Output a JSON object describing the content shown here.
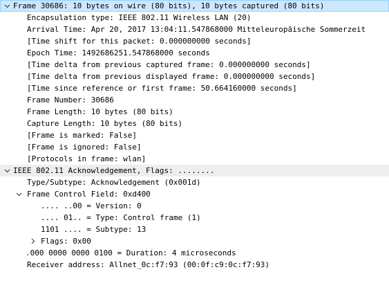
{
  "frame": {
    "header": "Frame 30686: 10 bytes on wire (80 bits), 10 bytes captured (80 bits)",
    "fields": [
      "Encapsulation type: IEEE 802.11 Wireless LAN (20)",
      "Arrival Time: Apr 20, 2017 13:04:11.547868000 Mitteleuropäische Sommerzeit",
      "[Time shift for this packet: 0.000000000 seconds]",
      "Epoch Time: 1492686251.547868000 seconds",
      "[Time delta from previous captured frame: 0.000000000 seconds]",
      "[Time delta from previous displayed frame: 0.000000000 seconds]",
      "[Time since reference or first frame: 50.664160000 seconds]",
      "Frame Number: 30686",
      "Frame Length: 10 bytes (80 bits)",
      "Capture Length: 10 bytes (80 bits)",
      "[Frame is marked: False]",
      "[Frame is ignored: False]",
      "[Protocols in frame: wlan]"
    ]
  },
  "wlan": {
    "header": "IEEE 802.11 Acknowledgement, Flags: ........",
    "type_subtype": "Type/Subtype: Acknowledgement (0x001d)",
    "fcf": {
      "header": "Frame Control Field: 0xd400",
      "bits": [
        ".... ..00 = Version: 0",
        ".... 01.. = Type: Control frame (1)",
        "1101 .... = Subtype: 13"
      ],
      "flags": "Flags: 0x00"
    },
    "duration": ".000 0000 0000 0100 = Duration: 4 microseconds",
    "receiver": "Receiver address: Allnet_0c:f7:93 (00:0f:c9:0c:f7:93)"
  },
  "icons": {
    "expanded": "chevron-down-icon",
    "collapsed": "chevron-right-icon"
  },
  "colors": {
    "selected_bg": "#cce8ff",
    "selected_border": "#99d1ff",
    "section_bg": "#eeeeee"
  }
}
